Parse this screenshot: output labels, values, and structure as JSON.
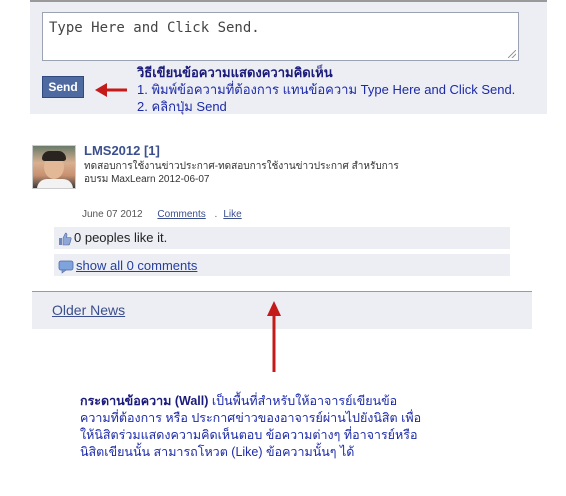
{
  "composer": {
    "text_value": "Type Here and Click Send.",
    "send_label": "Send"
  },
  "instructions": {
    "title": "วิธีเขียนข้อความแสดงความคิดเห็น",
    "step1": "1. พิมพ์ข้อความที่ต้องการ แทนข้อความ Type Here and Click Send.",
    "step2": "2. คลิกปุ่ม Send"
  },
  "post": {
    "author": "LMS2012 [1]",
    "body_line1": "ทดสอบการใช้งานข่าวประกาศ-ทดสอบการใช้งานข่าวประกาศ สำหรับการ",
    "body_line2": "อบรม MaxLearn 2012-06-07",
    "date": "June 07 2012",
    "comments_link": "Comments",
    "separator": ".",
    "like_link": "Like",
    "likes_text": "0 peoples like it.",
    "show_comments": "show all 0 comments"
  },
  "older_news": "Older News",
  "wall_note": {
    "bold": "กระดานข้อความ (Wall)",
    "line1_rest": " เป็นพื้นที่สำหรับให้อาจารย์เขียนข้อ",
    "line2": "ความที่ต้องการ หรือ ประกาศข่าวของอาจารย์ผ่านไปยังนิสิต เพื่อ",
    "line3": "ให้นิสิตร่วมแสดงความคิดเห็นตอบ ข้อความต่างๆ ที่อาจารย์หรือ",
    "line4": "นิสิตเขียนนั้น สามารถโหวต (Like) ข้อความนั้นๆ ได้"
  },
  "icons": {
    "like": "thumbs-up-icon",
    "comment": "comment-bubble-icon"
  },
  "colors": {
    "accent": "#3b4f8c",
    "annotation": "#1c2aa8",
    "arrow": "#c41a1a",
    "panel": "#eceef4"
  }
}
